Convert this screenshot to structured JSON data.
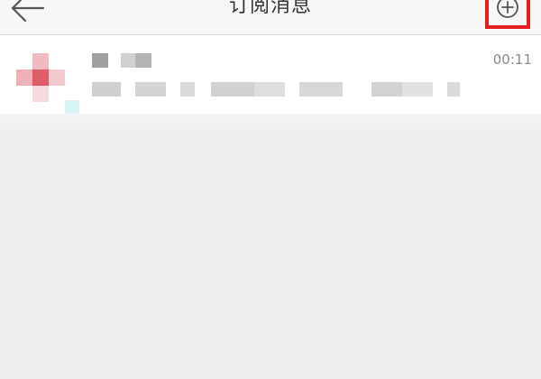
{
  "header": {
    "title": "订阅消息",
    "back_icon": "back-arrow-icon",
    "add_icon": "plus-circle-icon",
    "highlight_color": "#e61e1e"
  },
  "messages": [
    {
      "avatar_color": "#e05a68",
      "time": "00:11"
    }
  ]
}
